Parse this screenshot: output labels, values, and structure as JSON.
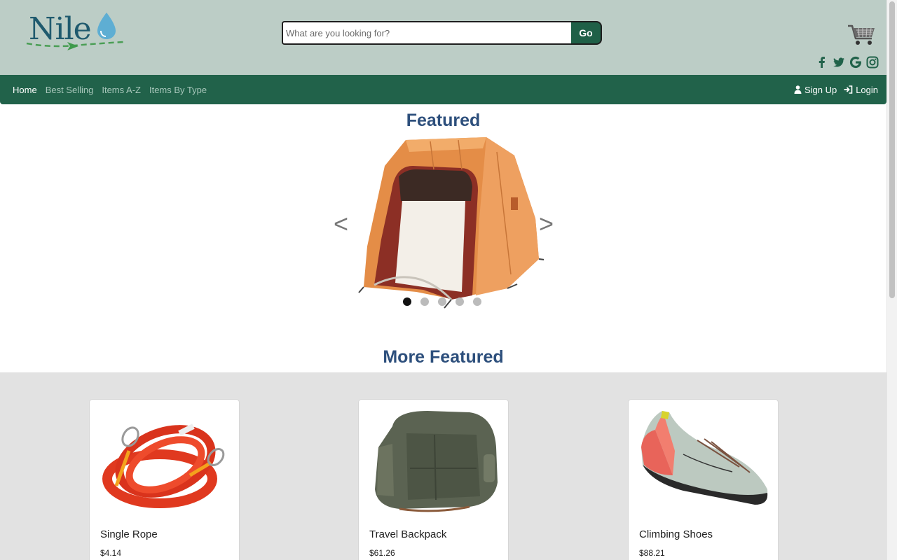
{
  "brand": {
    "logo_text": "Nile"
  },
  "search": {
    "placeholder": "What are you looking for?",
    "value": "",
    "button_label": "Go"
  },
  "header_icons": [
    "cart-icon",
    "facebook-icon",
    "twitter-icon",
    "google-icon",
    "instagram-icon"
  ],
  "nav": {
    "items": [
      {
        "label": "Home",
        "active": true
      },
      {
        "label": "Best Selling",
        "active": false
      },
      {
        "label": "Items A-Z",
        "active": false
      },
      {
        "label": "Items By Type",
        "active": false
      }
    ],
    "signup_label": "Sign Up",
    "login_label": "Login"
  },
  "featured": {
    "title": "Featured",
    "prev_label": "<",
    "next_label": ">",
    "slide_count": 5,
    "active_slide": 1,
    "current_image": "orange-tent"
  },
  "more_featured": {
    "title": "More Featured",
    "products": [
      {
        "name": "Single Rope",
        "price": "$4.14",
        "image": "red-climbing-rope"
      },
      {
        "name": "Travel Backpack",
        "price": "$61.26",
        "image": "green-backpack"
      },
      {
        "name": "Climbing Shoes",
        "price": "$88.21",
        "image": "climbing-shoe"
      }
    ]
  },
  "colors": {
    "header_bg": "#bccdc6",
    "nav_bg": "#21624a",
    "title_blue": "#2d4f7c",
    "grid_bg": "#e2e2e2"
  }
}
